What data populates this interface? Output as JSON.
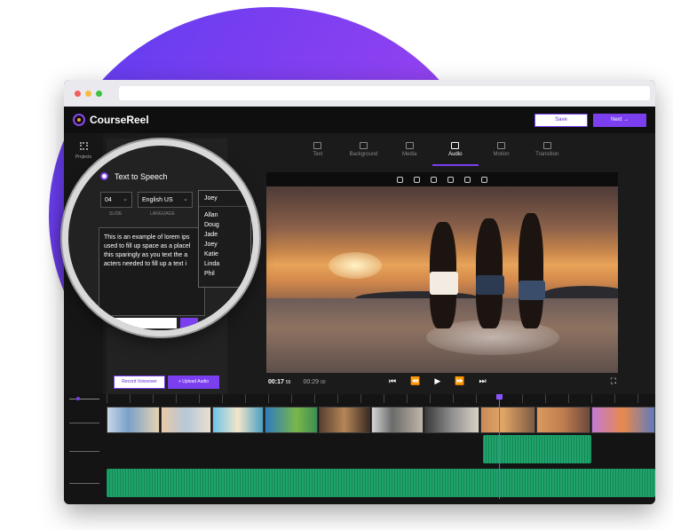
{
  "app": {
    "name": "CourseReel"
  },
  "header": {
    "save_label": "Save",
    "next_label": "Next →"
  },
  "sidebar": {
    "items": [
      {
        "label": "Projects"
      }
    ]
  },
  "tabs": [
    {
      "label": "Text"
    },
    {
      "label": "Background"
    },
    {
      "label": "Media"
    },
    {
      "label": "Audio",
      "active": true
    },
    {
      "label": "Motion"
    },
    {
      "label": "Transition"
    }
  ],
  "tts": {
    "label": "Text to Speech",
    "slide_value": "04",
    "slide_caption": "SLIDE",
    "language_value": "English US",
    "language_caption": "LANGUAGE",
    "voice_selected": "Joey",
    "voice_options": [
      "Allan",
      "Doug",
      "Jade",
      "Joey",
      "Katie",
      "Linda",
      "Phil"
    ],
    "text": "This is an example of lorem ips used to fill up space as a placel this sparingly as you text the a acters needed to fill up a text i"
  },
  "panel_buttons": {
    "record": "Record Voiceover",
    "upload": "+ Upload Audio"
  },
  "player": {
    "current_time": "00:17",
    "current_ms": "55",
    "total_time": "00:29",
    "total_ms": "00"
  },
  "colors": {
    "accent": "#7b3ff0",
    "audio_track": "#1ea46b",
    "playhead": "#8a55ff"
  }
}
